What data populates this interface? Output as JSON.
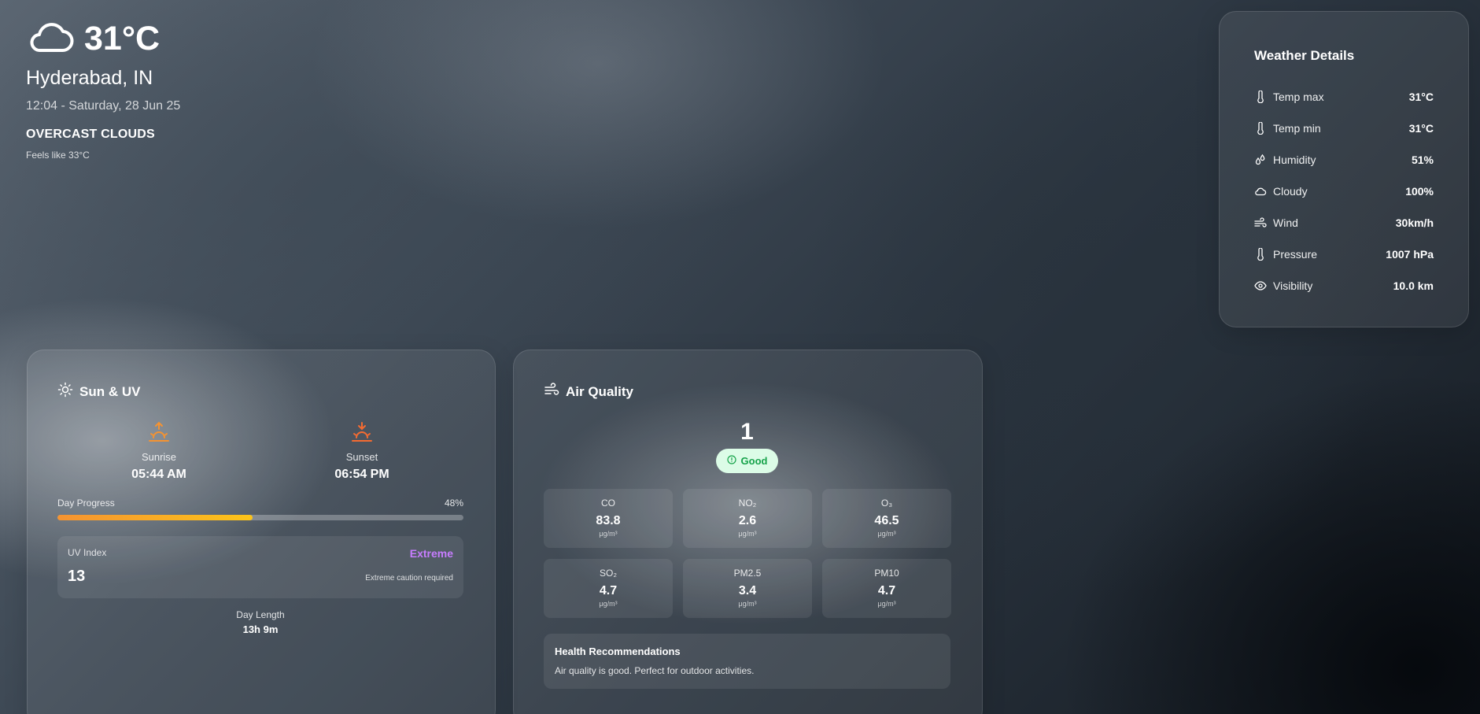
{
  "current": {
    "temperature": "31°C",
    "location": "Hyderabad, IN",
    "datetime": "12:04 - Saturday, 28 Jun 25",
    "condition": "OVERCAST CLOUDS",
    "feels_like": "Feels like 33°C",
    "icon": "cloud-icon"
  },
  "details": {
    "title": "Weather Details",
    "rows": [
      {
        "label": "Temp max",
        "value": "31°C",
        "icon": "thermometer-icon"
      },
      {
        "label": "Temp min",
        "value": "31°C",
        "icon": "thermometer-icon"
      },
      {
        "label": "Humidity",
        "value": "51%",
        "icon": "droplets-icon"
      },
      {
        "label": "Cloudy",
        "value": "100%",
        "icon": "cloud-icon"
      },
      {
        "label": "Wind",
        "value": "30km/h",
        "icon": "wind-icon"
      },
      {
        "label": "Pressure",
        "value": "1007 hPa",
        "icon": "thermometer-icon"
      },
      {
        "label": "Visibility",
        "value": "10.0 km",
        "icon": "eye-icon"
      }
    ]
  },
  "sun": {
    "title": "Sun & UV",
    "sunrise_label": "Sunrise",
    "sunrise_time": "05:44 AM",
    "sunset_label": "Sunset",
    "sunset_time": "06:54 PM",
    "progress_label": "Day Progress",
    "progress_text": "48%",
    "progress_value": 0.48,
    "uv_label": "UV Index",
    "uv_value": "13",
    "uv_level": "Extreme",
    "uv_note": "Extreme caution required",
    "day_length_label": "Day Length",
    "day_length": "13h 9m",
    "accent_color": "#f59331",
    "uv_color": "#c77dff"
  },
  "air": {
    "title": "Air Quality",
    "aqi": "1",
    "status": "Good",
    "status_color": "#16a34a",
    "pollutants": [
      {
        "name": "CO",
        "value": "83.8",
        "unit": "μg/m³"
      },
      {
        "name": "NO₂",
        "value": "2.6",
        "unit": "μg/m³"
      },
      {
        "name": "O₃",
        "value": "46.5",
        "unit": "μg/m³"
      },
      {
        "name": "SO₂",
        "value": "4.7",
        "unit": "μg/m³"
      },
      {
        "name": "PM2.5",
        "value": "3.4",
        "unit": "μg/m³"
      },
      {
        "name": "PM10",
        "value": "4.7",
        "unit": "μg/m³"
      }
    ],
    "health_title": "Health Recommendations",
    "health_text": "Air quality is good. Perfect for outdoor activities."
  }
}
